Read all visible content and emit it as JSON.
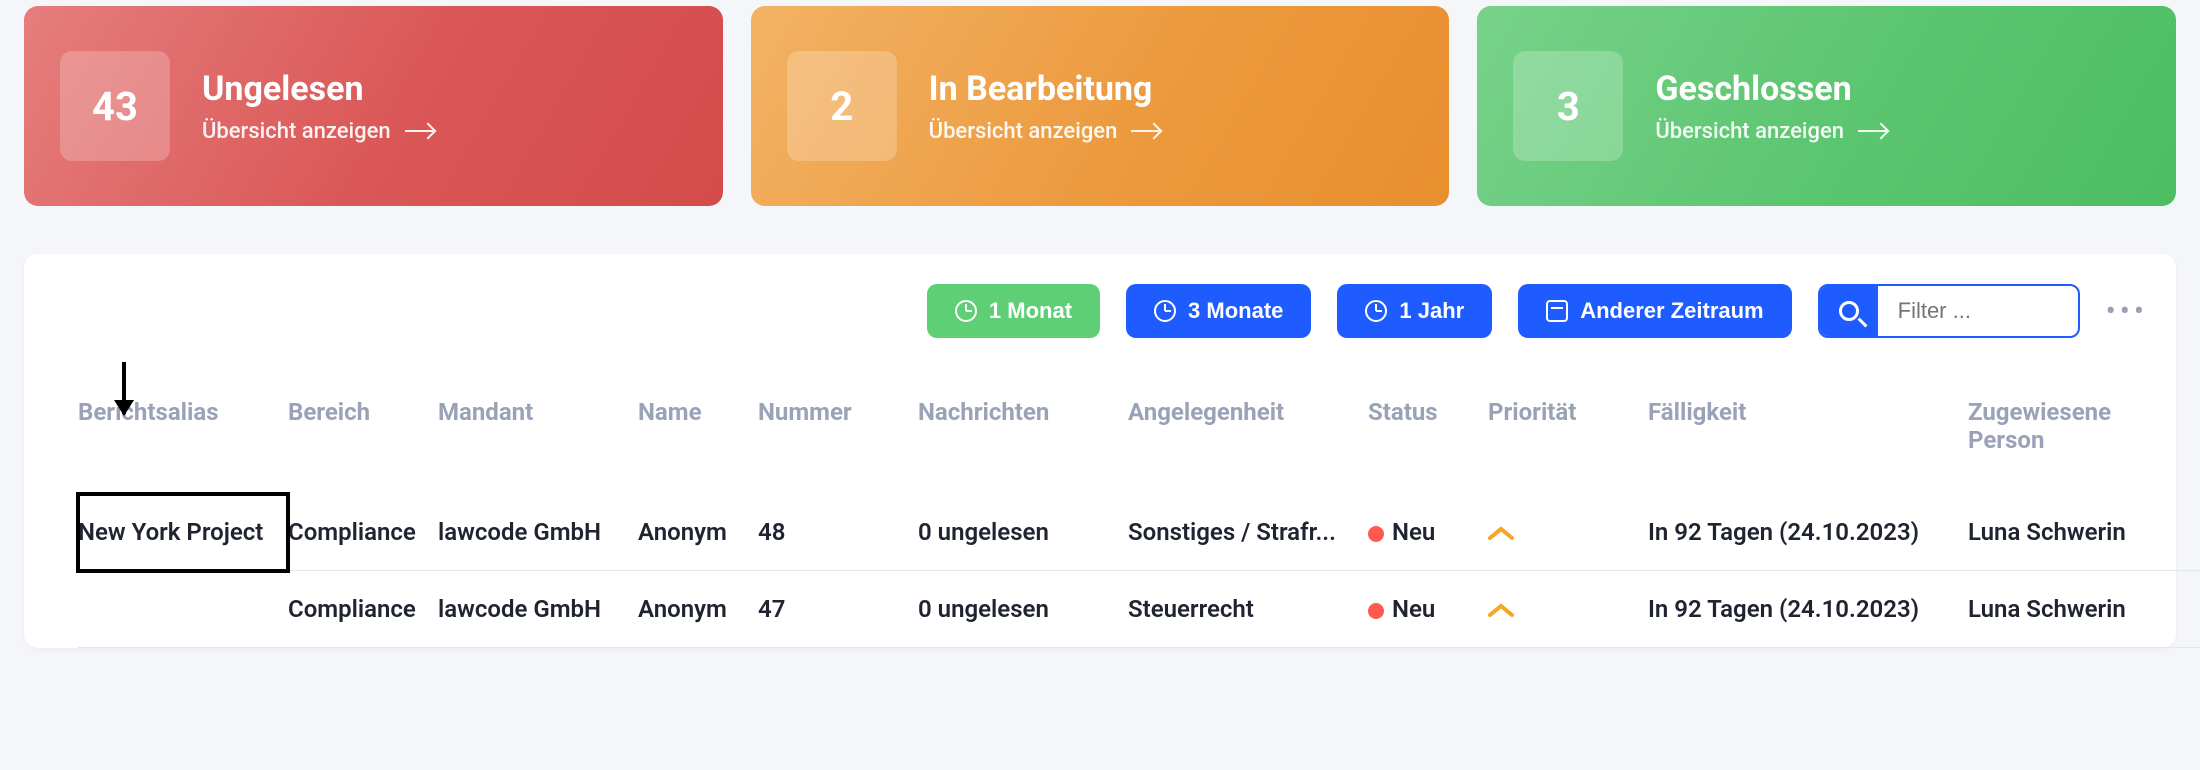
{
  "cards": [
    {
      "count": "43",
      "title": "Ungelesen",
      "subtitle": "Übersicht anzeigen"
    },
    {
      "count": "2",
      "title": "In Bearbeitung",
      "subtitle": "Übersicht anzeigen"
    },
    {
      "count": "3",
      "title": "Geschlossen",
      "subtitle": "Übersicht anzeigen"
    }
  ],
  "toolbar": {
    "range_1m": "1 Monat",
    "range_3m": "3 Monate",
    "range_1y": "1 Jahr",
    "range_custom": "Anderer Zeitraum",
    "filter_placeholder": "Filter ..."
  },
  "columns": {
    "alias": "Berichtsalias",
    "bereich": "Bereich",
    "mandant": "Mandant",
    "name": "Name",
    "nummer": "Nummer",
    "nachrichten": "Nachrichten",
    "angelegenheit": "Angelegenheit",
    "status": "Status",
    "prioritaet": "Priorität",
    "faelligkeit": "Fälligkeit",
    "person": "Zugewiesene Person"
  },
  "rows": [
    {
      "alias": "New York Project",
      "bereich": "Compliance",
      "mandant": "lawcode GmbH",
      "name": "Anonym",
      "nummer": "48",
      "nachrichten": "0 ungelesen",
      "angelegenheit": "Sonstiges / Strafr...",
      "status": "Neu",
      "status_color": "#ff5a4d",
      "prioritaet_icon": "caret-up",
      "faelligkeit": "In 92 Tagen (24.10.2023)",
      "person": "Luna Schwerin"
    },
    {
      "alias": "",
      "bereich": "Compliance",
      "mandant": "lawcode GmbH",
      "name": "Anonym",
      "nummer": "47",
      "nachrichten": "0 ungelesen",
      "angelegenheit": "Steuerrecht",
      "status": "Neu",
      "status_color": "#ff5a4d",
      "prioritaet_icon": "caret-up",
      "faelligkeit": "In 92 Tagen (24.10.2023)",
      "person": "Luna Schwerin"
    }
  ]
}
